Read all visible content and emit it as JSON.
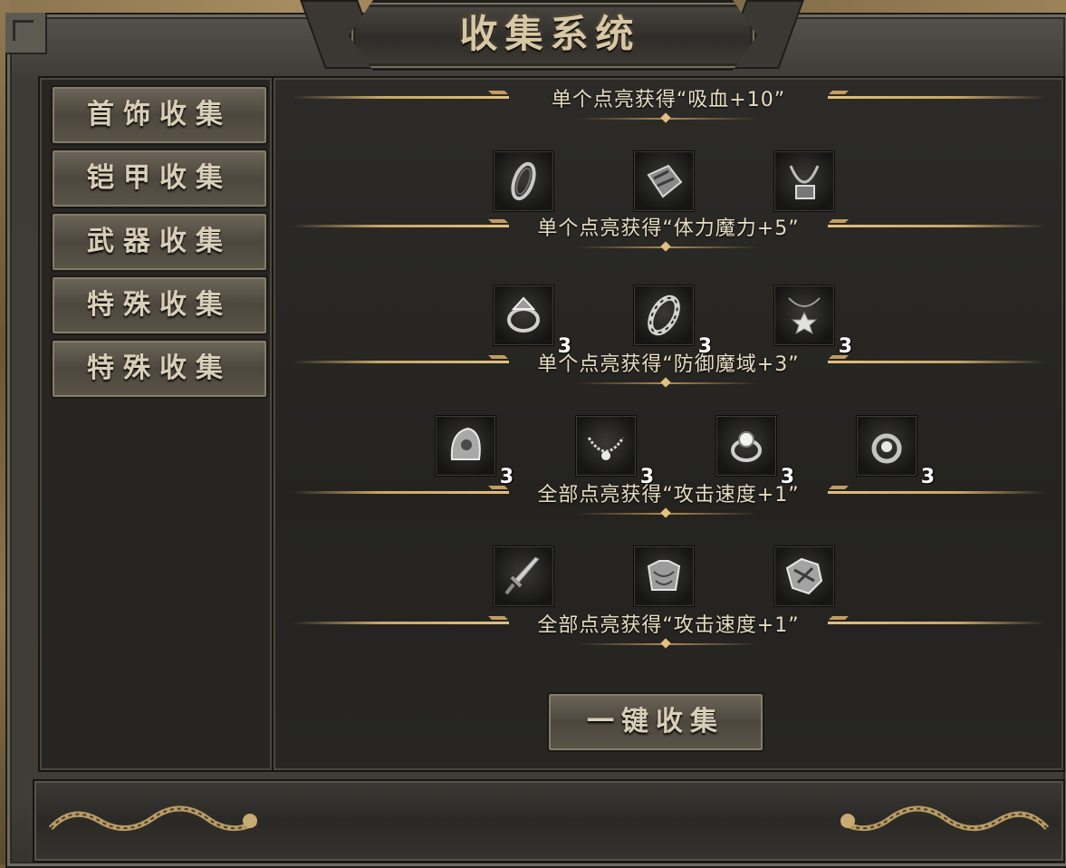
{
  "window": {
    "title": "收集系统"
  },
  "sidebar": {
    "tabs": [
      {
        "label": "首饰收集"
      },
      {
        "label": "铠甲收集"
      },
      {
        "label": "武器收集"
      },
      {
        "label": "特殊收集"
      },
      {
        "label": "特殊收集"
      }
    ]
  },
  "sections": [
    {
      "reward": "单个点亮获得“吸血+10”",
      "items": [
        {
          "icon": "bracelet-icon",
          "count": ""
        },
        {
          "icon": "gauntlet-icon",
          "count": ""
        },
        {
          "icon": "necklace-icon",
          "count": ""
        }
      ]
    },
    {
      "reward": "单个点亮获得“体力魔力+5”",
      "items": [
        {
          "icon": "ring-icon",
          "count": "3"
        },
        {
          "icon": "bracelet-icon",
          "count": "3"
        },
        {
          "icon": "amulet-icon",
          "count": "3"
        }
      ]
    },
    {
      "reward": "单个点亮获得“防御魔域+3”",
      "items": [
        {
          "icon": "helmet-icon",
          "count": "3"
        },
        {
          "icon": "necklace-icon",
          "count": "3"
        },
        {
          "icon": "ring-icon",
          "count": "3"
        },
        {
          "icon": "ring-icon",
          "count": "3"
        }
      ]
    },
    {
      "reward": "全部点亮获得“攻击速度+1”",
      "items": [
        {
          "icon": "sword-icon",
          "count": ""
        },
        {
          "icon": "armor-icon",
          "count": ""
        },
        {
          "icon": "armor-icon",
          "count": ""
        }
      ]
    },
    {
      "reward": "全部点亮获得“攻击速度+1”",
      "items": []
    }
  ],
  "actions": {
    "collect_all": "一键收集"
  },
  "colors": {
    "accent_gold": "#c7a468",
    "text_light": "#e7dcc1",
    "panel_dark": "#262522"
  }
}
